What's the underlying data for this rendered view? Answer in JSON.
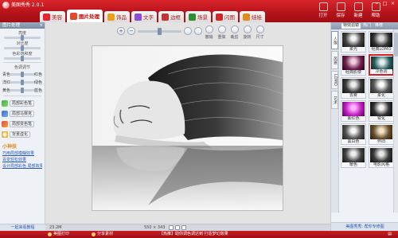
{
  "app": {
    "title": "美图秀秀 2.0.1"
  },
  "tabs": [
    {
      "label": "美容"
    },
    {
      "label": "图片处理"
    },
    {
      "label": "饰品"
    },
    {
      "label": "文字"
    },
    {
      "label": "边框"
    },
    {
      "label": "场景"
    },
    {
      "label": "闪图"
    },
    {
      "label": "娃娃"
    }
  ],
  "toolbar": {
    "open_label": "打开",
    "save_label": "保存",
    "new_label": "新建",
    "help_label": "帮助",
    "minimize": "–",
    "maximize": "□",
    "close": "×"
  },
  "left_panel": {
    "header": "图片处理",
    "close": "×",
    "sliders": [
      {
        "label": "亮度",
        "value": 0.5
      },
      {
        "label": "对比度",
        "value": 0.5
      },
      {
        "label": "色彩饱和度",
        "value": 0.5
      }
    ],
    "balance_title": "色调调节",
    "balance": [
      {
        "left": "青色",
        "right": "红色",
        "value": 0.5
      },
      {
        "left": "洋红",
        "right": "绿色",
        "value": 0.5
      },
      {
        "left": "黄色",
        "right": "蓝色",
        "value": 0.5
      }
    ],
    "buttons": [
      {
        "label": "局部彩色笔"
      },
      {
        "label": "局部马赛克"
      },
      {
        "label": "局部变色笔"
      },
      {
        "label": "背景虚化"
      }
    ],
    "tips_title": "小神技",
    "tips": [
      "巧用局部模糊效果",
      "百变轻松效果",
      "设计局部彩色 局部效果"
    ],
    "footer": "一起来看教程"
  },
  "canvas": {
    "zoom_in": "+",
    "zoom_out": "−",
    "zoom_level": 0.5,
    "tools": [
      {
        "label": "撤销"
      },
      {
        "label": "重做"
      },
      {
        "label": "裁剪"
      },
      {
        "label": "旋转"
      },
      {
        "label": "尺寸"
      }
    ],
    "status_left": "23.2M",
    "status_size": "550 × 343"
  },
  "right_panel": {
    "tabs": [
      {
        "label": "特效滤镜"
      },
      {
        "label": "热门"
      },
      {
        "label": "推荐"
      }
    ],
    "side_tabs": [
      {
        "label": "人像"
      },
      {
        "label": "风景"
      },
      {
        "label": "LOMO"
      },
      {
        "label": "艺术"
      }
    ],
    "effects": [
      {
        "label": "柔光"
      },
      {
        "label": "经典LOMO"
      },
      {
        "label": "经典影楼"
      },
      {
        "label": "冷色调"
      },
      {
        "label": "去雾"
      },
      {
        "label": "柔化"
      },
      {
        "label": "紫红色"
      },
      {
        "label": "锐化"
      },
      {
        "label": "黑白色"
      },
      {
        "label": "怀旧"
      },
      {
        "label": "暖色"
      },
      {
        "label": "电影风格"
      }
    ],
    "selected_effect": "冷色调",
    "footer": "美图秀秀: 帮你专修图"
  },
  "statusbar": {
    "left1": "美图打印",
    "left2": "分享素材",
    "center": "【热推】助你调色调达到 打造梦幻效果"
  }
}
